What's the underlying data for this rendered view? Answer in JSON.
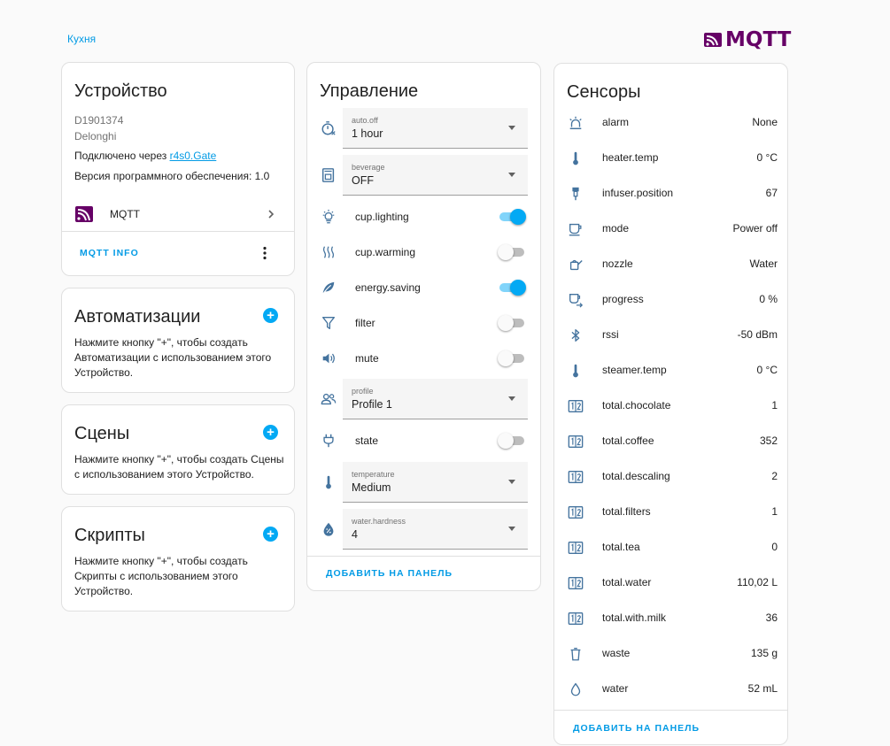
{
  "breadcrumb": "Кухня",
  "logo_text": "MQTT",
  "device": {
    "title": "Устройство",
    "model": "D1901374",
    "manufacturer": "Delonghi",
    "connected_prefix": "Подключено через ",
    "connected_link": "r4s0.Gate",
    "firmware": "Версия программного обеспечения: 1.0",
    "integration": "MQTT",
    "mqtt_info": "MQTT INFO"
  },
  "automations": {
    "title": "Автоматизации",
    "text": "Нажмите кнопку \"+\", чтобы создать Автоматизации с использованием этого Устройство."
  },
  "scenes": {
    "title": "Сцены",
    "text": "Нажмите кнопку \"+\", чтобы создать Сцены с использованием этого Устройство."
  },
  "scripts": {
    "title": "Скрипты",
    "text": "Нажмите кнопку \"+\", чтобы создать Скрипты с использованием этого Устройство."
  },
  "controls": {
    "title": "Управление",
    "add_to_panel": "ДОБАВИТЬ НА ПАНЕЛЬ",
    "auto_off": {
      "label": "auto.off",
      "value": "1 hour",
      "icon": "timer-off-icon"
    },
    "beverage": {
      "label": "beverage",
      "value": "OFF",
      "icon": "coffee-maker-icon"
    },
    "cup_lighting": {
      "label": "cup.lighting",
      "on": true,
      "icon": "lightbulb-icon"
    },
    "cup_warming": {
      "label": "cup.warming",
      "on": false,
      "icon": "heat-waves-icon"
    },
    "energy_saving": {
      "label": "energy.saving",
      "on": true,
      "icon": "leaf-icon"
    },
    "filter": {
      "label": "filter",
      "on": false,
      "icon": "filter-icon"
    },
    "mute": {
      "label": "mute",
      "on": false,
      "icon": "speaker-icon"
    },
    "profile": {
      "label": "profile",
      "value": "Profile 1",
      "icon": "account-group-icon"
    },
    "state": {
      "label": "state",
      "on": false,
      "icon": "power-plug-icon"
    },
    "temperature": {
      "label": "temperature",
      "value": "Medium",
      "icon": "thermometer-icon"
    },
    "water_hardness": {
      "label": "water.hardness",
      "value": "4",
      "icon": "water-percent-icon"
    }
  },
  "sensors": {
    "title": "Сенсоры",
    "add_to_panel": "ДОБАВИТЬ НА ПАНЕЛЬ",
    "items": [
      {
        "name": "alarm",
        "value": "None",
        "icon": "alarm-light-icon"
      },
      {
        "name": "heater.temp",
        "value": "0 °C",
        "icon": "thermometer-icon"
      },
      {
        "name": "infuser.position",
        "value": "67",
        "icon": "infuser-icon"
      },
      {
        "name": "mode",
        "value": "Power off",
        "icon": "coffee-cup-icon"
      },
      {
        "name": "nozzle",
        "value": "Water",
        "icon": "watering-can-icon"
      },
      {
        "name": "progress",
        "value": "0 %",
        "icon": "coffee-to-go-icon"
      },
      {
        "name": "rssi",
        "value": "-50 dBm",
        "icon": "bluetooth-icon"
      },
      {
        "name": "steamer.temp",
        "value": "0 °C",
        "icon": "thermometer-icon"
      },
      {
        "name": "total.chocolate",
        "value": "1",
        "icon": "counter-icon"
      },
      {
        "name": "total.coffee",
        "value": "352",
        "icon": "counter-icon"
      },
      {
        "name": "total.descaling",
        "value": "2",
        "icon": "counter-icon"
      },
      {
        "name": "total.filters",
        "value": "1",
        "icon": "counter-icon"
      },
      {
        "name": "total.tea",
        "value": "0",
        "icon": "counter-icon"
      },
      {
        "name": "total.water",
        "value": "110,02 L",
        "icon": "counter-icon"
      },
      {
        "name": "total.with.milk",
        "value": "36",
        "icon": "counter-icon"
      },
      {
        "name": "waste",
        "value": "135 g",
        "icon": "trash-can-icon"
      },
      {
        "name": "water",
        "value": "52 mL",
        "icon": "water-drop-icon"
      }
    ]
  },
  "colors": {
    "accent": "#03a9f4",
    "icon": "#44739e",
    "mqtt": "#660066"
  }
}
